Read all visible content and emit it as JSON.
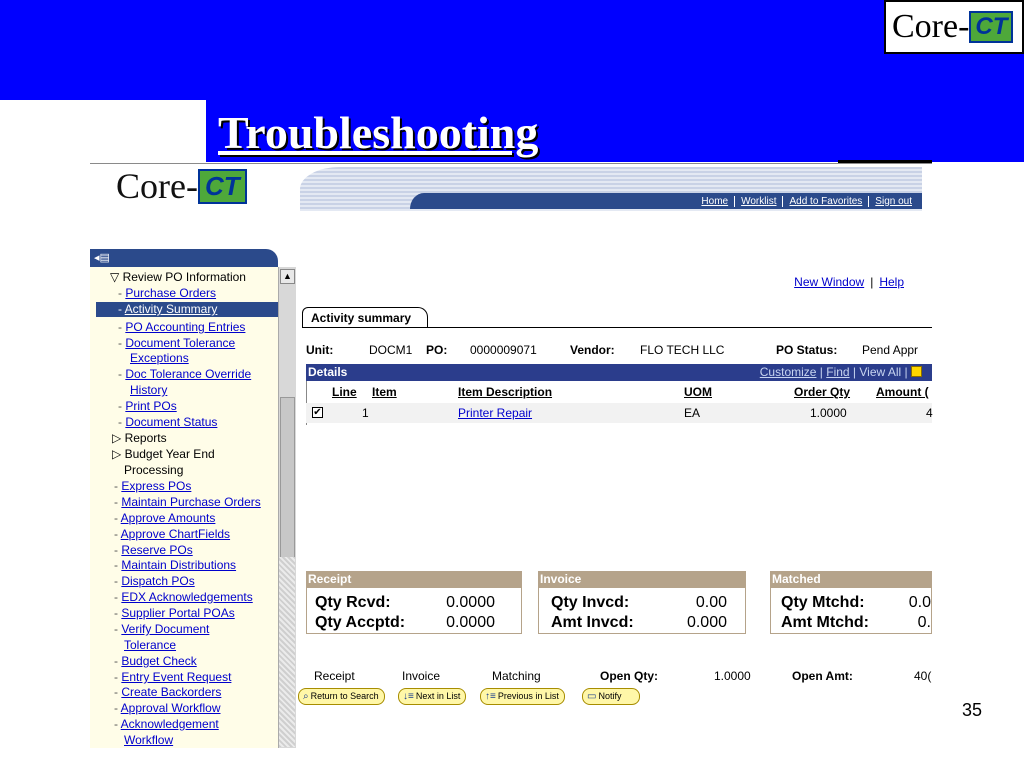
{
  "slide": {
    "title": "Troubleshooting",
    "logo": {
      "prefix": "Core-",
      "mark": "CT"
    },
    "page_number": "35"
  },
  "app": {
    "logo": {
      "prefix": "Core-",
      "mark": "CT"
    },
    "nav": [
      "Home",
      "Worklist",
      "Add to Favorites",
      "Sign out"
    ],
    "top_links": [
      "New Window",
      "Help"
    ]
  },
  "menu": {
    "items": [
      {
        "text": "Review PO Information",
        "type": "folder-open"
      },
      {
        "text": "Purchase Orders",
        "type": "link"
      },
      {
        "text": "Activity Summary",
        "type": "link-selected"
      },
      {
        "text": "PO Accounting Entries",
        "type": "link"
      },
      {
        "text": "Document Tolerance",
        "type": "link"
      },
      {
        "text": "Exceptions",
        "type": "link-cont"
      },
      {
        "text": "Doc Tolerance Override",
        "type": "link"
      },
      {
        "text": "History",
        "type": "link-cont"
      },
      {
        "text": "Print POs",
        "type": "link"
      },
      {
        "text": "Document Status",
        "type": "link"
      },
      {
        "text": "Reports",
        "type": "folder"
      },
      {
        "text": "Budget Year End",
        "type": "folder"
      },
      {
        "text": "Processing",
        "type": "text-cont"
      },
      {
        "text": "Express POs",
        "type": "link"
      },
      {
        "text": "Maintain Purchase Orders",
        "type": "link"
      },
      {
        "text": "Approve Amounts",
        "type": "link"
      },
      {
        "text": "Approve ChartFields",
        "type": "link"
      },
      {
        "text": "Reserve POs",
        "type": "link"
      },
      {
        "text": "Maintain Distributions",
        "type": "link"
      },
      {
        "text": "Dispatch POs",
        "type": "link"
      },
      {
        "text": "EDX Acknowledgements",
        "type": "link"
      },
      {
        "text": "Supplier Portal POAs",
        "type": "link"
      },
      {
        "text": "Verify Document",
        "type": "link"
      },
      {
        "text": "Tolerance",
        "type": "link-cont"
      },
      {
        "text": "Budget Check",
        "type": "link"
      },
      {
        "text": "Entry Event Request",
        "type": "link"
      },
      {
        "text": "Create Backorders",
        "type": "link"
      },
      {
        "text": "Approval Workflow",
        "type": "link"
      },
      {
        "text": "Acknowledgement",
        "type": "link"
      },
      {
        "text": "Workflow",
        "type": "link-cont"
      }
    ]
  },
  "page": {
    "tab": "Activity summary",
    "header": {
      "unit_label": "Unit:",
      "unit": "DOCM1",
      "po_label": "PO:",
      "po": "0000009071",
      "vendor_label": "Vendor:",
      "vendor": "FLO TECH LLC",
      "status_label": "PO Status:",
      "status": "Pend Appr"
    },
    "details": {
      "title": "Details",
      "tools": [
        "Customize",
        "Find",
        "View All"
      ],
      "columns": [
        "Line",
        "Item",
        "Item Description",
        "UOM",
        "Order Qty",
        "Amount ("
      ],
      "rows": [
        {
          "checked": "✔",
          "line": "1",
          "item": "",
          "description": "Printer Repair",
          "uom": "EA",
          "order_qty": "1.0000",
          "amount": "4"
        }
      ]
    },
    "receipt": {
      "title": "Receipt",
      "qty_rcvd_label": "Qty Rcvd:",
      "qty_rcvd": "0.0000",
      "qty_accptd_label": "Qty Accptd:",
      "qty_accptd": "0.0000"
    },
    "invoice": {
      "title": "Invoice",
      "qty_invcd_label": "Qty Invcd:",
      "qty_invcd": "0.00",
      "amt_invcd_label": "Amt Invcd:",
      "amt_invcd": "0.000"
    },
    "matched": {
      "title": "Matched",
      "qty_mtchd_label": "Qty Mtchd:",
      "qty_mtchd": "0.0",
      "amt_mtchd_label": "Amt Mtchd:",
      "amt_mtchd": "0."
    },
    "totals": {
      "receipt": "Receipt",
      "invoice": "Invoice",
      "matching": "Matching",
      "open_qty_label": "Open Qty:",
      "open_qty": "1.0000",
      "open_amt_label": "Open Amt:",
      "open_amt": "40("
    },
    "buttons": [
      "Return to Search",
      "Next in List",
      "Previous in List",
      "Notify"
    ]
  },
  "colors": {
    "slide_blue": "#0000ff",
    "portal_navy": "#2b4a8b",
    "details_bar": "#2b3d8c",
    "summary_tan": "#b5a38a",
    "menu_bg": "#fffde8",
    "link_blue": "#0000cc",
    "button_yellow": "#fff7a8"
  }
}
